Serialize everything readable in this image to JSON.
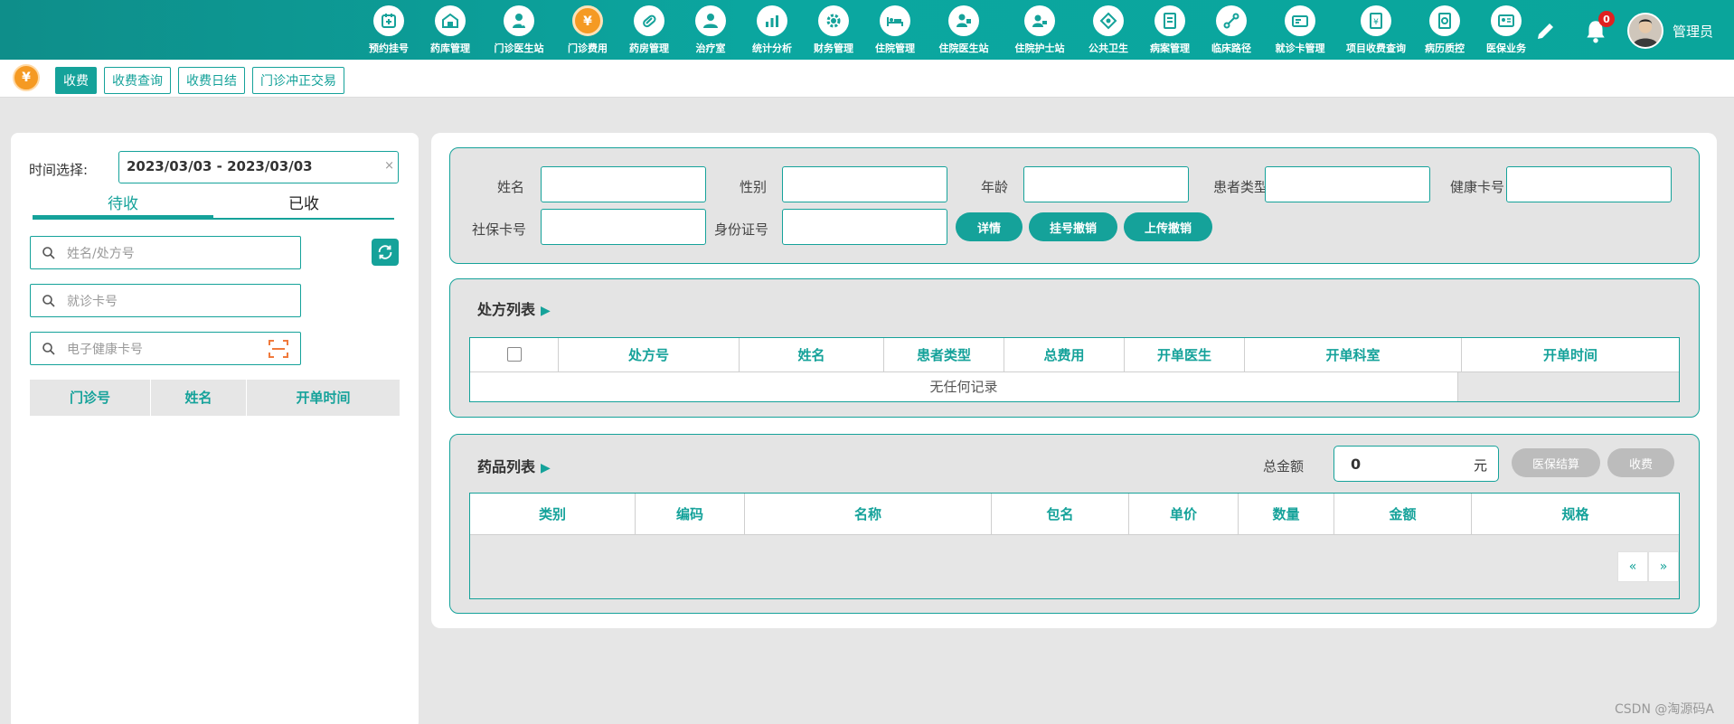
{
  "topnav": {
    "items": [
      {
        "label": "预约挂号",
        "icon": "calendar-plus-icon"
      },
      {
        "label": "药库管理",
        "icon": "warehouse-icon"
      },
      {
        "label": "门诊医生站",
        "icon": "doctor-icon"
      },
      {
        "label": "门诊费用",
        "icon": "yen-coin-icon",
        "active": true
      },
      {
        "label": "药房管理",
        "icon": "pill-icon"
      },
      {
        "label": "治疗室",
        "icon": "treatment-person-icon"
      },
      {
        "label": "统计分析",
        "icon": "bar-chart-icon"
      },
      {
        "label": "财务管理",
        "icon": "gear-money-icon"
      },
      {
        "label": "住院管理",
        "icon": "hospital-bed-icon"
      },
      {
        "label": "住院医生站",
        "icon": "inpatient-doctor-icon"
      },
      {
        "label": "住院护士站",
        "icon": "nurse-icon"
      },
      {
        "label": "公共卫生",
        "icon": "public-health-icon"
      },
      {
        "label": "病案管理",
        "icon": "medical-record-icon"
      },
      {
        "label": "临床路径",
        "icon": "clinical-path-icon"
      },
      {
        "label": "就诊卡管理",
        "icon": "id-card-icon"
      },
      {
        "label": "项目收费查询",
        "icon": "fee-query-icon"
      },
      {
        "label": "病历质控",
        "icon": "record-quality-icon"
      },
      {
        "label": "医保业务",
        "icon": "insurance-card-icon"
      }
    ],
    "notification_count": "0",
    "username": "管理员"
  },
  "subnav": {
    "coin_symbol": "¥",
    "tabs": [
      "收费",
      "收费查询",
      "收费日结",
      "门诊冲正交易"
    ]
  },
  "left": {
    "time_label": "时间选择:",
    "date_range": "2023/03/03 - 2023/03/03",
    "clear_symbol": "×",
    "tabs": [
      "待收",
      "已收"
    ],
    "search_name_placeholder": "姓名/处方号",
    "search_card_placeholder": "就诊卡号",
    "search_health_placeholder": "电子健康卡号",
    "columns": [
      "门诊号",
      "姓名",
      "开单时间"
    ]
  },
  "patient_form": {
    "name": "姓名",
    "gender": "性别",
    "age": "年龄",
    "patient_type": "患者类型",
    "health_card": "健康卡号",
    "social_card": "社保卡号",
    "id_number": "身份证号",
    "btn_detail": "详情",
    "btn_cancel_register": "挂号撤销",
    "btn_upload_cancel": "上传撤销"
  },
  "prescriptions": {
    "title": "处方列表",
    "columns": [
      "处方号",
      "姓名",
      "患者类型",
      "总费用",
      "开单医生",
      "开单科室",
      "开单时间"
    ],
    "empty_text": "无任何记录"
  },
  "drugs": {
    "title": "药品列表",
    "total_label": "总金额",
    "total_value": "0",
    "total_unit": "元",
    "btn_insurance": "医保结算",
    "btn_charge": "收费",
    "columns": [
      "类别",
      "编码",
      "名称",
      "包名",
      "单价",
      "数量",
      "金额",
      "规格"
    ],
    "pager_prev": "«",
    "pager_next": "»"
  },
  "watermark": "CSDN @淘源码A",
  "colors": {
    "accent": "#15a29a",
    "active_orange": "#f59a23",
    "badge": "#e02020"
  }
}
